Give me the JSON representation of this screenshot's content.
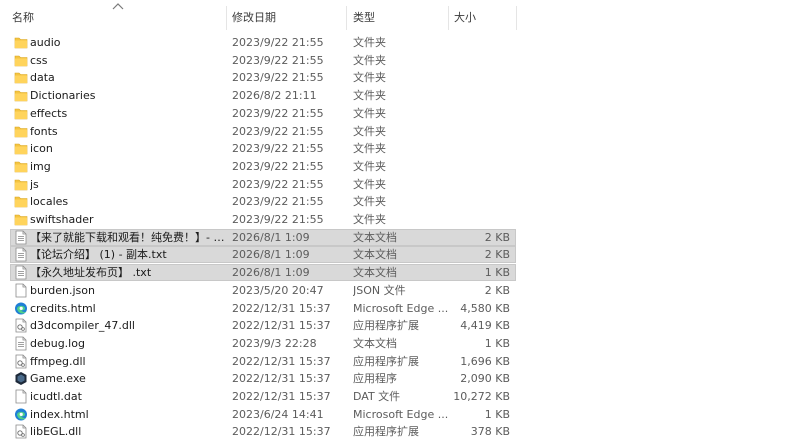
{
  "columns": {
    "name": "名称",
    "date": "修改日期",
    "type": "类型",
    "size": "大小"
  },
  "colors": {
    "folder": "#f4c542",
    "selected_row": "#d9d9d9",
    "edge_blue": "#1f7fd6",
    "game_dark": "#1e2a3a"
  },
  "files": [
    {
      "icon": "folder-icon",
      "name": "audio",
      "date": "2023/9/22 21:55",
      "type": "文件夹",
      "size": ""
    },
    {
      "icon": "folder-icon",
      "name": "css",
      "date": "2023/9/22 21:55",
      "type": "文件夹",
      "size": ""
    },
    {
      "icon": "folder-icon",
      "name": "data",
      "date": "2023/9/22 21:55",
      "type": "文件夹",
      "size": ""
    },
    {
      "icon": "folder-icon",
      "name": "Dictionaries",
      "date": "2026/8/2 21:11",
      "type": "文件夹",
      "size": ""
    },
    {
      "icon": "folder-icon",
      "name": "effects",
      "date": "2023/9/22 21:55",
      "type": "文件夹",
      "size": ""
    },
    {
      "icon": "folder-icon",
      "name": "fonts",
      "date": "2023/9/22 21:55",
      "type": "文件夹",
      "size": ""
    },
    {
      "icon": "folder-icon",
      "name": "icon",
      "date": "2023/9/22 21:55",
      "type": "文件夹",
      "size": ""
    },
    {
      "icon": "folder-icon",
      "name": "img",
      "date": "2023/9/22 21:55",
      "type": "文件夹",
      "size": ""
    },
    {
      "icon": "folder-icon",
      "name": "js",
      "date": "2023/9/22 21:55",
      "type": "文件夹",
      "size": ""
    },
    {
      "icon": "folder-icon",
      "name": "locales",
      "date": "2023/9/22 21:55",
      "type": "文件夹",
      "size": ""
    },
    {
      "icon": "folder-icon",
      "name": "swiftshader",
      "date": "2023/9/22 21:55",
      "type": "文件夹",
      "size": ""
    },
    {
      "icon": "text-file-icon",
      "name": "【来了就能下载和观看！纯免费！】- 副...",
      "date": "2026/8/1 1:09",
      "type": "文本文档",
      "size": "2 KB",
      "selected": true
    },
    {
      "icon": "text-file-icon",
      "name": "【论坛介绍】 (1) - 副本.txt",
      "date": "2026/8/1 1:09",
      "type": "文本文档",
      "size": "2 KB",
      "selected": true
    },
    {
      "icon": "text-file-icon",
      "name": "【永久地址发布页】 .txt",
      "date": "2026/8/1 1:09",
      "type": "文本文档",
      "size": "1 KB",
      "selected": true
    },
    {
      "icon": "blank-file-icon",
      "name": "burden.json",
      "date": "2023/5/20 20:47",
      "type": "JSON 文件",
      "size": "2 KB"
    },
    {
      "icon": "edge-html-icon",
      "name": "credits.html",
      "date": "2022/12/31 15:37",
      "type": "Microsoft Edge ...",
      "size": "4,580 KB"
    },
    {
      "icon": "dll-file-icon",
      "name": "d3dcompiler_47.dll",
      "date": "2022/12/31 15:37",
      "type": "应用程序扩展",
      "size": "4,419 KB"
    },
    {
      "icon": "text-file-icon",
      "name": "debug.log",
      "date": "2023/9/3 22:28",
      "type": "文本文档",
      "size": "1 KB"
    },
    {
      "icon": "dll-file-icon",
      "name": "ffmpeg.dll",
      "date": "2022/12/31 15:37",
      "type": "应用程序扩展",
      "size": "1,696 KB"
    },
    {
      "icon": "game-exe-icon",
      "name": "Game.exe",
      "date": "2022/12/31 15:37",
      "type": "应用程序",
      "size": "2,090 KB"
    },
    {
      "icon": "blank-file-icon",
      "name": "icudtl.dat",
      "date": "2022/12/31 15:37",
      "type": "DAT 文件",
      "size": "10,272 KB"
    },
    {
      "icon": "edge-html-icon",
      "name": "index.html",
      "date": "2023/6/24 14:41",
      "type": "Microsoft Edge ...",
      "size": "1 KB"
    },
    {
      "icon": "dll-file-icon",
      "name": "libEGL.dll",
      "date": "2022/12/31 15:37",
      "type": "应用程序扩展",
      "size": "378 KB"
    }
  ]
}
